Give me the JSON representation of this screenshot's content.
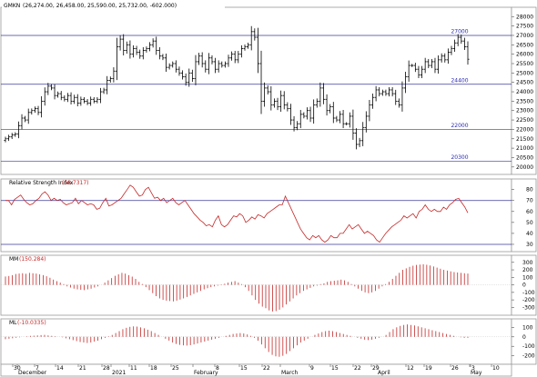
{
  "chart_data": [
    {
      "type": "ohlc",
      "title": "GMKN",
      "ohlc_label": "(26,274.00, 26,458.00, 25,590.00, 25,732.00, -602.000)",
      "ylim": [
        19700,
        28400
      ],
      "yticks": [
        20000,
        20500,
        21000,
        21500,
        22000,
        22500,
        23000,
        23500,
        24000,
        24500,
        25000,
        25500,
        26000,
        26500,
        27000,
        27500,
        28000
      ],
      "hlines": [
        27000,
        24400,
        22000,
        20300
      ],
      "hline_labels": [
        "27000",
        "24400",
        "22000",
        "20300"
      ],
      "closes": [
        21500,
        21600,
        21700,
        21750,
        22200,
        22600,
        22500,
        22900,
        23000,
        23100,
        22900,
        23500,
        24000,
        24300,
        24200,
        23800,
        23900,
        23700,
        23600,
        23800,
        23500,
        23700,
        23400,
        23600,
        23500,
        23400,
        23600,
        23500,
        23600,
        24000,
        24100,
        24600,
        24700,
        25100,
        26400,
        26800,
        26200,
        26500,
        26000,
        26300,
        26100,
        25900,
        26200,
        26300,
        26500,
        26700,
        26200,
        25900,
        25800,
        25300,
        25400,
        25500,
        25200,
        25000,
        24800,
        24500,
        25000,
        24700,
        25600,
        25900,
        25500,
        25200,
        25800,
        25600,
        25200,
        25500,
        25400,
        25500,
        25800,
        26000,
        25700,
        26000,
        26300,
        26400,
        26500,
        27200,
        26900,
        25500,
        23500,
        24200,
        24000,
        23300,
        23500,
        23200,
        23800,
        23300,
        23100,
        22500,
        22100,
        22300,
        22800,
        22700,
        23000,
        22600,
        23300,
        23500,
        24200,
        23600,
        23000,
        23200,
        22600,
        22500,
        22800,
        22300,
        22300,
        22700,
        21800,
        21200,
        21400,
        22100,
        22700,
        23300,
        23700,
        24100,
        23900,
        24000,
        23900,
        24100,
        23900,
        23500,
        23300,
        24200,
        24800,
        25400,
        25400,
        25200,
        24900,
        25200,
        25600,
        25400,
        25600,
        25200,
        25700,
        25900,
        25700,
        26100,
        26300,
        26600,
        26900,
        26700,
        26400,
        25732
      ],
      "xlabels": [
        "30",
        "December",
        "7",
        "14",
        "21",
        "28",
        "2021",
        "11",
        "18",
        "25",
        "February",
        "8",
        "15",
        "22",
        "March",
        "9",
        "15",
        "22",
        "29",
        "April",
        "12",
        "19",
        "26",
        "3",
        "May",
        "10"
      ]
    },
    {
      "type": "line",
      "title": "Relative Strength Index",
      "value_label": "(58.7317)",
      "ylim": [
        25,
        88
      ],
      "yticks": [
        30,
        40,
        50,
        60,
        70,
        80
      ],
      "hlines": [
        70,
        30
      ],
      "values": [
        70,
        70,
        66,
        71,
        73,
        75,
        71,
        68,
        66,
        67,
        70,
        72,
        76,
        78,
        75,
        70,
        72,
        70,
        71,
        68,
        66,
        67,
        68,
        72,
        67,
        70,
        68,
        66,
        67,
        66,
        62,
        63,
        68,
        72,
        65,
        66,
        68,
        70,
        72,
        76,
        80,
        84,
        82,
        78,
        74,
        75,
        80,
        82,
        77,
        72,
        73,
        70,
        72,
        68,
        70,
        72,
        68,
        66,
        68,
        70,
        66,
        62,
        58,
        55,
        52,
        50,
        47,
        48,
        46,
        52,
        56,
        48,
        46,
        48,
        52,
        56,
        55,
        58,
        56,
        50,
        52,
        55,
        53,
        57,
        56,
        54,
        58,
        60,
        62,
        64,
        66,
        66,
        74,
        68,
        62,
        56,
        50,
        44,
        40,
        36,
        34,
        38,
        36,
        38,
        34,
        32,
        34,
        38,
        36,
        36,
        40,
        40,
        44,
        48,
        44,
        46,
        48,
        44,
        40,
        42,
        40,
        38,
        34,
        32,
        36,
        40,
        43,
        46,
        48,
        50,
        52,
        56,
        54,
        56,
        58,
        54,
        60,
        62,
        66,
        62,
        60,
        62,
        60,
        60,
        64,
        62,
        66,
        68,
        71,
        72,
        68,
        64,
        58.7
      ]
    },
    {
      "type": "bar",
      "title": "MM",
      "value_label": "(150.284)",
      "ylim": [
        -380,
        370
      ],
      "yticks": [
        -300,
        -200,
        -100,
        0,
        100,
        200,
        300
      ],
      "values": [
        112,
        118,
        130,
        145,
        150,
        155,
        148,
        160,
        155,
        150,
        140,
        130,
        115,
        95,
        70,
        50,
        30,
        10,
        -20,
        -35,
        -50,
        -60,
        -65,
        -70,
        -60,
        -50,
        -35,
        -20,
        0,
        30,
        60,
        90,
        120,
        140,
        160,
        150,
        130,
        110,
        80,
        40,
        10,
        -30,
        -70,
        -110,
        -150,
        -180,
        -200,
        -210,
        -215,
        -220,
        -210,
        -195,
        -180,
        -160,
        -140,
        -120,
        -100,
        -80,
        -60,
        -45,
        -30,
        -20,
        -10,
        5,
        15,
        30,
        40,
        50,
        30,
        10,
        -30,
        -80,
        -140,
        -200,
        -250,
        -290,
        -310,
        -340,
        -355,
        -350,
        -330,
        -300,
        -260,
        -220,
        -180,
        -140,
        -110,
        -80,
        -60,
        -40,
        -20,
        -10,
        10,
        20,
        40,
        50,
        55,
        60,
        70,
        60,
        40,
        10,
        -20,
        -50,
        -80,
        -100,
        -110,
        -100,
        -80,
        -50,
        -20,
        10,
        40,
        80,
        120,
        160,
        200,
        220,
        240,
        255,
        265,
        270,
        275,
        268,
        258,
        245,
        230,
        215,
        200,
        190,
        180,
        170,
        165,
        160,
        155,
        150.3
      ]
    },
    {
      "type": "bar",
      "title": "ML",
      "value_label": "(-10.0335)",
      "ylim": [
        -270,
        170
      ],
      "yticks": [
        -200,
        -100,
        0,
        100
      ],
      "values": [
        -25,
        -20,
        -15,
        -10,
        -5,
        0,
        5,
        10,
        12,
        15,
        18,
        20,
        15,
        10,
        5,
        0,
        -5,
        -15,
        -25,
        -35,
        -45,
        -55,
        -60,
        -65,
        -60,
        -50,
        -40,
        -25,
        -10,
        5,
        20,
        40,
        60,
        80,
        95,
        105,
        110,
        108,
        100,
        90,
        75,
        60,
        40,
        20,
        0,
        -20,
        -40,
        -60,
        -75,
        -85,
        -90,
        -92,
        -88,
        -80,
        -70,
        -60,
        -50,
        -40,
        -30,
        -20,
        -10,
        0,
        10,
        20,
        30,
        35,
        40,
        35,
        25,
        10,
        -10,
        -40,
        -80,
        -120,
        -160,
        -190,
        -205,
        -210,
        -200,
        -180,
        -150,
        -120,
        -90,
        -60,
        -40,
        -20,
        0,
        20,
        35,
        50,
        60,
        65,
        60,
        50,
        40,
        30,
        20,
        10,
        0,
        -10,
        -20,
        -30,
        -35,
        -30,
        -20,
        -10,
        0,
        20,
        50,
        80,
        100,
        115,
        125,
        130,
        125,
        120,
        110,
        100,
        90,
        80,
        70,
        60,
        50,
        40,
        30,
        20,
        10,
        0,
        -5,
        -10,
        -10.03
      ]
    }
  ]
}
